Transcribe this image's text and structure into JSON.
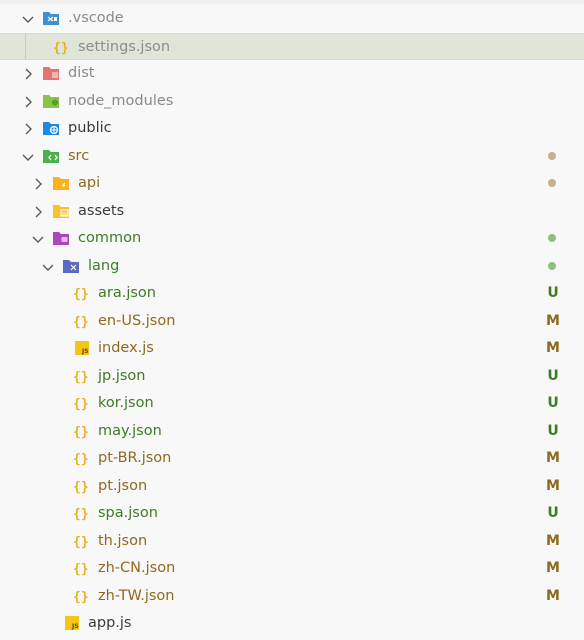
{
  "colors": {
    "untracked": "#3d7b25",
    "modified": "#8d6a1e",
    "dot_modified": "#c3b28a",
    "dot_untracked": "#8fbf7f",
    "selected_bg": "#dfe5d8"
  },
  "tree": [
    {
      "label": ".vscode",
      "icon": "vscode-folder-icon",
      "expanded": true
    },
    {
      "label": "settings.json",
      "icon": "json-braces-icon",
      "selected": true
    },
    {
      "label": "dist",
      "icon": "dist-folder-icon",
      "expanded": false
    },
    {
      "label": "node_modules",
      "icon": "node-folder-icon",
      "expanded": false
    },
    {
      "label": "public",
      "icon": "public-folder-icon",
      "expanded": false
    },
    {
      "label": "src",
      "icon": "src-folder-icon",
      "expanded": true
    },
    {
      "label": "api",
      "icon": "api-folder-icon",
      "expanded": false
    },
    {
      "label": "assets",
      "icon": "assets-folder-icon",
      "expanded": false
    },
    {
      "label": "common",
      "icon": "common-folder-icon",
      "expanded": true
    },
    {
      "label": "lang",
      "icon": "lang-folder-icon",
      "expanded": true
    },
    {
      "label": "ara.json",
      "icon": "json-braces-icon",
      "badge": "U"
    },
    {
      "label": "en-US.json",
      "icon": "json-braces-icon",
      "badge": "M"
    },
    {
      "label": "index.js",
      "icon": "js-file-icon",
      "badge": "M"
    },
    {
      "label": "jp.json",
      "icon": "json-braces-icon",
      "badge": "U"
    },
    {
      "label": "kor.json",
      "icon": "json-braces-icon",
      "badge": "U"
    },
    {
      "label": "may.json",
      "icon": "json-braces-icon",
      "badge": "U"
    },
    {
      "label": "pt-BR.json",
      "icon": "json-braces-icon",
      "badge": "M"
    },
    {
      "label": "pt.json",
      "icon": "json-braces-icon",
      "badge": "M"
    },
    {
      "label": "spa.json",
      "icon": "json-braces-icon",
      "badge": "U"
    },
    {
      "label": "th.json",
      "icon": "json-braces-icon",
      "badge": "M"
    },
    {
      "label": "zh-CN.json",
      "icon": "json-braces-icon",
      "badge": "M"
    },
    {
      "label": "zh-TW.json",
      "icon": "json-braces-icon",
      "badge": "M"
    },
    {
      "label": "app.js",
      "icon": "js-file-icon"
    }
  ]
}
